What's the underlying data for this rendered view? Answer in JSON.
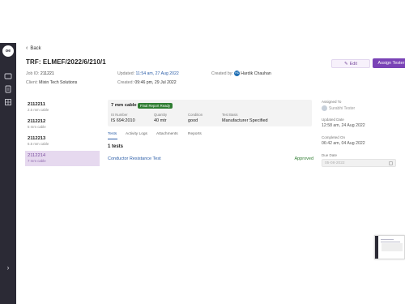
{
  "sidebar": {
    "logo_text": "oe",
    "icons": [
      "dashboard-icon",
      "document-icon",
      "grid-icon"
    ],
    "expand_glyph": "›"
  },
  "header": {
    "back_label": "Back",
    "title": "TRF: ELMEF/2022/6/210/1",
    "edit_label": "Edit",
    "assign_label": "Assign Tester"
  },
  "meta": {
    "job_id_label": "Job ID:",
    "job_id": "211221",
    "client_label": "Client:",
    "client": "Mixin Tech Solutions",
    "updated_label": "Updated:",
    "updated": "11:54 am, 27 Aug 2022",
    "created_label": "Created:",
    "created": "09:46 pm, 29 Jul 2022",
    "created_by_label": "Created by:",
    "created_by": "Hardik Chauhan",
    "created_by_initials": "HC"
  },
  "trf_list": [
    {
      "id": "2112211",
      "sub": "2.5 mm cable"
    },
    {
      "id": "2112212",
      "sub": "5 mm cable"
    },
    {
      "id": "2112213",
      "sub": "6.5 mm cable"
    },
    {
      "id": "2112214",
      "sub": "7 mm cable"
    }
  ],
  "detail": {
    "title": "7 mm cable",
    "status_badge": "Final Report Ready",
    "fields": [
      {
        "label": "IS Number",
        "value": "IS 694:2010"
      },
      {
        "label": "Quantity",
        "value": "40 mtr"
      },
      {
        "label": "Condition",
        "value": "good"
      },
      {
        "label": "Test Basis",
        "value": "Manufacturer Specified"
      }
    ]
  },
  "tabs": [
    "Tests",
    "Activity Logs",
    "Attachments",
    "Reports"
  ],
  "tests": {
    "count_label": "1 tests",
    "rows": [
      {
        "name": "Conductor Resistance Test",
        "status": "Approved"
      }
    ]
  },
  "right_panel": {
    "assigned_label": "Assigned To",
    "assignee": "Surabhi Tester",
    "updated_label": "Updated Date",
    "updated": "12:58 am, 24 Aug 2022",
    "completed_label": "Completed On",
    "completed": "06:42 am, 04 Aug 2022",
    "due_label": "Due Date",
    "due": "05-08-2022"
  },
  "colors": {
    "accent": "#7a43b6",
    "sidebar": "#2b2a35",
    "link": "#2c5ea8",
    "success": "#2f7d32",
    "active_row": "#e6d9ef"
  }
}
